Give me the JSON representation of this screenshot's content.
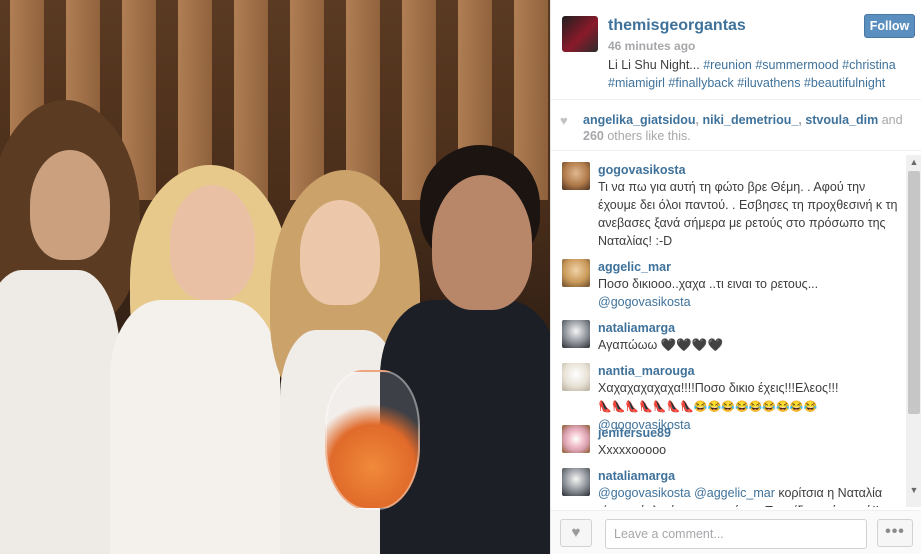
{
  "post": {
    "username": "themisgeorgantas",
    "time_ago": "46 minutes ago",
    "caption_text": "Li Li Shu Night... ",
    "hashtags": "#reunion #summermood #christina #miamigirl #finallyback #iluvathens #beautifulnight",
    "follow_label": "Follow"
  },
  "likes": {
    "user1": "angelika_giatsidou",
    "sep1": ", ",
    "user2": "niki_demetriou_",
    "sep2": ", ",
    "user3": "stvoula_dim",
    "and_text": " and",
    "count": "260",
    "tail": " others like this."
  },
  "comments": [
    {
      "username": "gogovasikosta",
      "text": "Τι να πω για αυτή τη φώτο βρε Θέμη. . Αφού την έχουμε δει όλοι παντού. . Εσβησες τη προχθεσινή κ τη ανεβασες ξανά σήμερα με ρετούς στο πρόσωπο της Ναταλίας! :-D",
      "avatar_color": "#b07a4a"
    },
    {
      "username": "aggelic_mar",
      "text": "Ποσο δικιοοο..χαχα ..τι ειναι το ρετους...",
      "mention": "@gogovasikosta",
      "avatar_color": "#c99a5a"
    },
    {
      "username": "nataliamarga",
      "text": "Αγαπώωω 🖤🖤🖤🖤",
      "avatar_color": "#8a8f96"
    },
    {
      "username": "nantia_marouga",
      "text": "Χαχαχαχαχαχα!!!!Ποσο δικιο έχεις!!!Ελεος!!!",
      "emoji_line": "👠👠👠👠👠👠👠😂😂😂😂😂😂😂😂😂",
      "mention": "@gogovasikosta",
      "avatar_color": "#e8e2d6"
    },
    {
      "username": "jenifersue89",
      "text": "Xxxxxooooo",
      "avatar_color": "#d9a0b0"
    },
    {
      "username": "nataliamarga",
      "mention1": "@gogovasikosta",
      "mention2": "@aggelic_mar",
      "text": " κορίτσια η Ναταλία είναι κούκλα ό,τι και να κάνει . Την είδα από κοντά!!",
      "avatar_color": "#8a8f96"
    }
  ],
  "footer": {
    "comment_placeholder": "Leave a comment...",
    "more_label": "•••"
  },
  "icons": {
    "heart": "heart-icon",
    "like_button": "heart-icon",
    "more": "ellipsis-icon",
    "scroll_up": "chevron-up-icon",
    "scroll_down": "chevron-down-icon"
  }
}
